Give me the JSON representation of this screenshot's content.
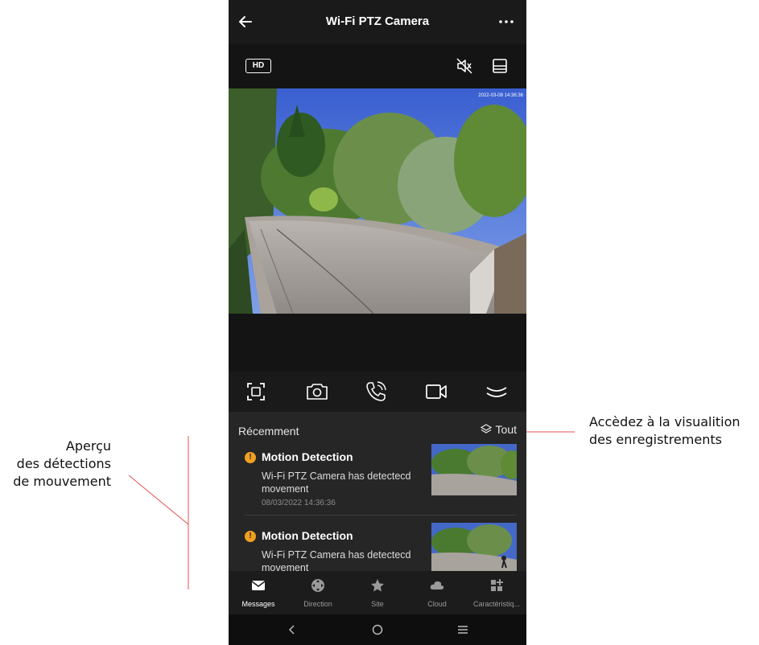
{
  "header": {
    "title": "Wi-Fi PTZ Camera"
  },
  "player": {
    "quality": "HD",
    "timestamp": "2022-03-08 14:36:36"
  },
  "recent": {
    "heading": "Récemment",
    "all_label": "Tout",
    "items": [
      {
        "title": "Motion Detection",
        "message": "Wi-Fi PTZ Camera  has detectecd movement",
        "time": "08/03/2022 14:36:36"
      },
      {
        "title": "Motion Detection",
        "message": "Wi-Fi PTZ Camera  has detectecd movement",
        "time": ""
      }
    ]
  },
  "tabs": [
    {
      "label": "Messages",
      "icon": "envelope-icon",
      "active": true
    },
    {
      "label": "Direction",
      "icon": "joystick-icon",
      "active": false
    },
    {
      "label": "Site",
      "icon": "star-icon",
      "active": false
    },
    {
      "label": "Cloud",
      "icon": "cloud-icon",
      "active": false
    },
    {
      "label": "Caractéristiq...",
      "icon": "grid-icon",
      "active": false
    }
  ],
  "annotations": {
    "left": [
      "Aperçu",
      "des détections",
      "de mouvement"
    ],
    "right": [
      "Accèdez à la visualition",
      "des enregistrements"
    ]
  },
  "colors": {
    "accent": "#f0a020",
    "annotation_line": "#e05050",
    "background": "#1f1f1f"
  }
}
